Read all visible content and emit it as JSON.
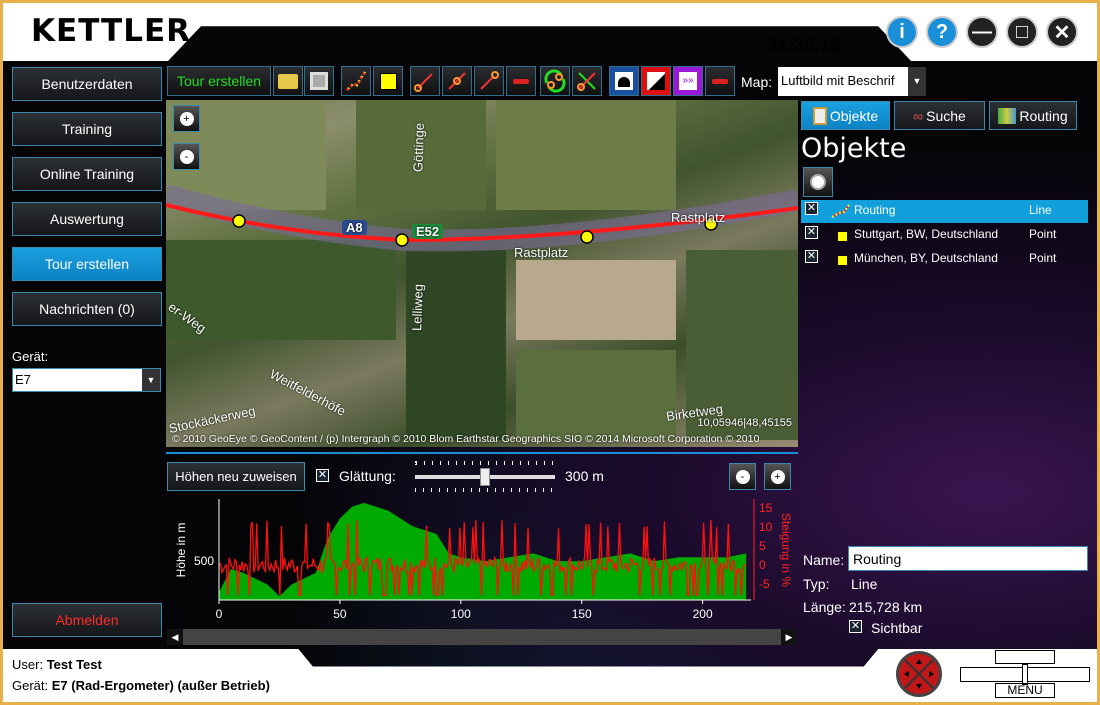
{
  "app": {
    "logo": "KETTLER",
    "clock": "11:35:15"
  },
  "window_buttons": [
    {
      "name": "info",
      "glyph": "i"
    },
    {
      "name": "help",
      "glyph": "?"
    },
    {
      "name": "minimize",
      "glyph": "—"
    },
    {
      "name": "maximize",
      "glyph": "□"
    },
    {
      "name": "close",
      "glyph": "✕"
    }
  ],
  "sidebar": {
    "items": [
      {
        "label": "Benutzerdaten"
      },
      {
        "label": "Training"
      },
      {
        "label": "Online Training"
      },
      {
        "label": "Auswertung"
      },
      {
        "label": "Tour erstellen",
        "active": true
      },
      {
        "label": "Nachrichten (0)"
      }
    ],
    "device_label": "Gerät:",
    "device_value": "E7",
    "logout": "Abmelden"
  },
  "toolbar": {
    "tour_erstellen": "Tour erstellen",
    "map_label": "Map:",
    "map_value": "Luftbild mit Beschrif",
    "icons": [
      "open-folder",
      "save-disk",
      "draw-route",
      "point-marker",
      "line-segment",
      "insert-point",
      "extend-line",
      "remove-segment",
      "reverse-route",
      "cut-route",
      "tunnel",
      "elevation",
      "fast-forward",
      "remove"
    ]
  },
  "map": {
    "labels": [
      "Göttinge",
      "A8",
      "E52",
      "Rastplatz",
      "Rastplatz",
      "Lelliweg",
      "er-Weg",
      "Weitfelderhöfe",
      "Stockäckerweg",
      "Birketweg"
    ],
    "coords": "10,05946|48,45155",
    "copyright": "© 2010 GeoEye © GeoContent / (p) Intergraph © 2010 Blom Earthstar Geographics  SIO © 2014 Microsoft Corporation © 2010",
    "route_color": "#ff1a1a"
  },
  "profile": {
    "reassign_button": "Höhen neu zuweisen",
    "smoothing_label": "Glättung:",
    "smoothing_checked": true,
    "smoothing_value": "300 m",
    "smoothing_fraction": 0.5,
    "ylabel_left": "Höhe in m",
    "ylabel_right": "Steigung in %",
    "left_ticks": [
      "500"
    ],
    "right_ticks": [
      "15",
      "10",
      "5",
      "0",
      "-5"
    ],
    "x_ticks": [
      "0",
      "50",
      "100",
      "150",
      "200"
    ],
    "elevation_color": "#00aa00",
    "gradient_color": "#ff1010"
  },
  "chart_data": {
    "type": "area",
    "xlabel": "",
    "ylabel": "Höhe in m",
    "xlim": [
      0,
      220
    ],
    "x": [
      0,
      5,
      10,
      20,
      25,
      30,
      40,
      45,
      50,
      55,
      60,
      70,
      80,
      90,
      95,
      100,
      110,
      120,
      130,
      140,
      150,
      160,
      170,
      180,
      190,
      200,
      210,
      218
    ],
    "elevation": [
      420,
      480,
      470,
      440,
      410,
      440,
      470,
      560,
      610,
      640,
      650,
      630,
      590,
      570,
      520,
      510,
      500,
      510,
      520,
      500,
      500,
      510,
      520,
      500,
      510,
      510,
      510,
      520
    ],
    "y2label": "Steigung in %",
    "y2lim": [
      -8,
      17
    ]
  },
  "panel": {
    "tabs": [
      {
        "label": "Objekte",
        "active": true
      },
      {
        "label": "Suche"
      },
      {
        "label": "Routing"
      }
    ],
    "title": "Objekte",
    "objects": [
      {
        "name": "Routing",
        "type": "Line",
        "checked": true,
        "selected": true
      },
      {
        "name": "Stuttgart, BW, Deutschland",
        "type": "Point",
        "checked": true
      },
      {
        "name": "München, BY, Deutschland",
        "type": "Point",
        "checked": true
      }
    ],
    "name_label": "Name:",
    "name_value": "Routing",
    "typ_label": "Typ:",
    "typ_value": "Line",
    "length_label": "Länge:",
    "length_value": "215,728 km",
    "visible_label": "Sichtbar",
    "visible_checked": true,
    "selected_color": "#12a0dc"
  },
  "footer": {
    "user_label": "User:",
    "user_value": "Test Test",
    "device_label": "Gerät:",
    "device_value": "E7 (Rad-Ergometer) (außer Betrieb)",
    "menu_label": "MENU"
  }
}
